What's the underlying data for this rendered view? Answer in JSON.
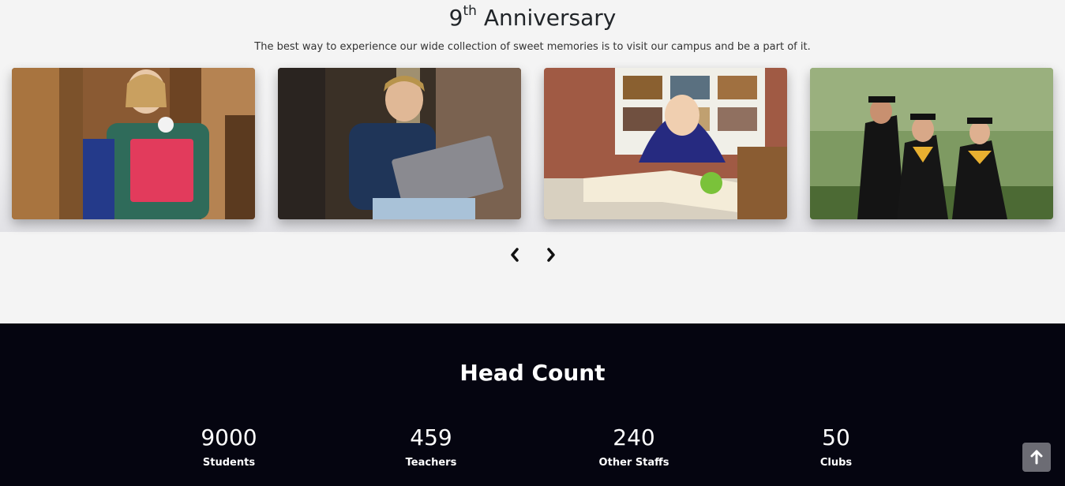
{
  "anniversary": {
    "title_number": "9",
    "title_suffix": "th",
    "title_text": "Anniversary",
    "subtitle": "The best way to experience our wide collection of sweet memories is to visit our campus and be a part of it."
  },
  "carousel": {
    "slides": [
      {
        "image": "student-holding-books-photo"
      },
      {
        "image": "student-with-laptop-photo"
      },
      {
        "image": "student-reading-book-photo"
      },
      {
        "image": "graduates-photo"
      }
    ],
    "prev_icon": "chevron-left-icon",
    "next_icon": "chevron-right-icon"
  },
  "head_count": {
    "title": "Head Count",
    "stats": [
      {
        "value": "9000",
        "label": "Students"
      },
      {
        "value": "459",
        "label": "Teachers"
      },
      {
        "value": "240",
        "label": "Other Staffs"
      },
      {
        "value": "50",
        "label": "Clubs"
      }
    ]
  },
  "scroll_top": {
    "icon": "arrow-up-icon"
  },
  "colors": {
    "dark_section": "#050510",
    "page_bg": "#f4f4f4"
  }
}
